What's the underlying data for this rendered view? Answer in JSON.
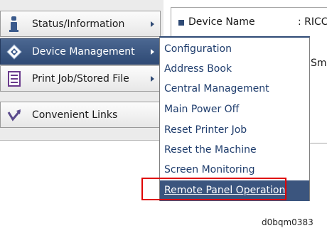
{
  "sidebar": {
    "items": [
      {
        "label": "Status/Information",
        "icon": "info-icon"
      },
      {
        "label": "Device Management",
        "icon": "device-management-icon"
      },
      {
        "label": "Print Job/Stored File",
        "icon": "print-job-icon"
      },
      {
        "label": "Convenient Links",
        "icon": "link-icon"
      }
    ]
  },
  "device_panel": {
    "label": "Device Name",
    "value": ": RICC",
    "partial_text": "Sma"
  },
  "submenu": {
    "items": [
      "Configuration",
      "Address Book",
      "Central Management",
      "Main Power Off",
      "Reset Printer Job",
      "Reset the Machine",
      "Screen Monitoring",
      "Remote Panel Operation"
    ],
    "highlighted": "Remote Panel Operation"
  },
  "caption": "d0bqm0383",
  "colors": {
    "accent": "#2f4a75",
    "highlight": "#3b557e",
    "callout_red": "#e00000"
  }
}
